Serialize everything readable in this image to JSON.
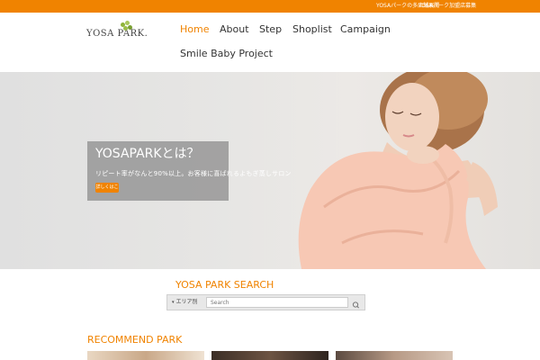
{
  "topbar": {
    "links": [
      "YOSAパークの多店舗展開",
      "YOSAパーク加盟店募集"
    ],
    "color": "#f08300"
  },
  "logo": {
    "text": "YOSA PARK."
  },
  "nav": {
    "items": [
      "Home",
      "About",
      "Step",
      "Shoplist",
      "Campaign",
      "Smile Baby Project"
    ],
    "active": "Home"
  },
  "hero": {
    "title": "YOSAPARKとは？",
    "subtitle": "リピート率がなんと90%以上。お客様に喜ばれるよもぎ蒸しサロン",
    "button_label": "詳しくはこ"
  },
  "search": {
    "title": "YOSA PARK SEARCH",
    "select_label": "エリア別",
    "placeholder": "Search"
  },
  "recommend": {
    "title": "RECOMMEND PARK"
  },
  "icons": [
    "search-icon",
    "chevron-down-icon",
    "leaf-icon"
  ]
}
